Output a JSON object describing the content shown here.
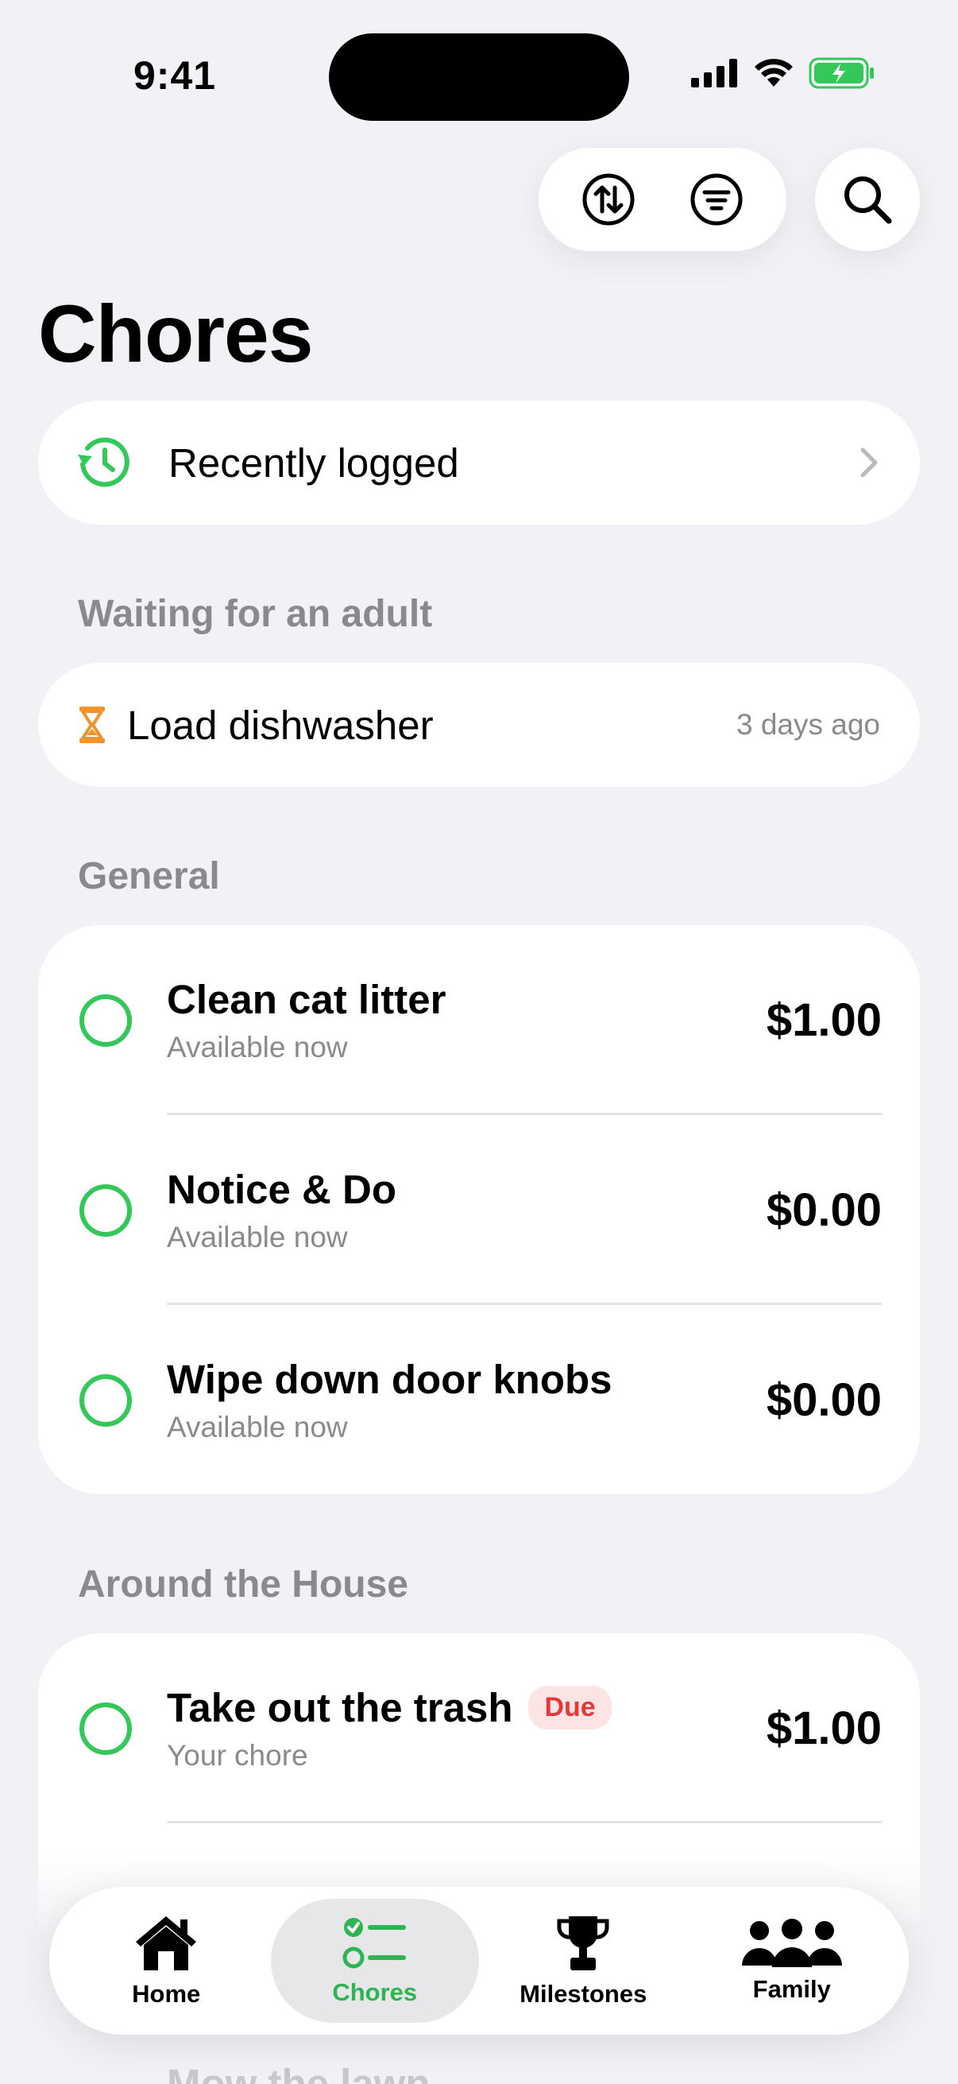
{
  "status_bar": {
    "time": "9:41"
  },
  "page": {
    "title": "Chores"
  },
  "recently_logged": {
    "label": "Recently logged"
  },
  "waiting": {
    "header": "Waiting for an adult",
    "item": {
      "label": "Load dishwasher",
      "time": "3 days ago"
    }
  },
  "general": {
    "header": "General",
    "items": [
      {
        "title": "Clean cat litter",
        "subtitle": "Available now",
        "price": "$1.00"
      },
      {
        "title": "Notice & Do",
        "subtitle": "Available now",
        "price": "$0.00"
      },
      {
        "title": "Wipe down door knobs",
        "subtitle": "Available now",
        "price": "$0.00"
      }
    ]
  },
  "around_house": {
    "header": "Around the House",
    "items": [
      {
        "title": "Take out the trash",
        "badge": "Due",
        "subtitle": "Your chore",
        "price": "$1.00"
      }
    ],
    "peek_item": "Mow the lawn"
  },
  "tabs": [
    {
      "label": "Home",
      "icon": "house-icon",
      "active": false
    },
    {
      "label": "Chores",
      "icon": "checklist-icon",
      "active": true
    },
    {
      "label": "Milestones",
      "icon": "trophy-icon",
      "active": false
    },
    {
      "label": "Family",
      "icon": "people-icon",
      "active": false
    }
  ],
  "colors": {
    "accent": "#34c759",
    "due_badge": "#e5383b",
    "hourglass": "#f0932b"
  }
}
